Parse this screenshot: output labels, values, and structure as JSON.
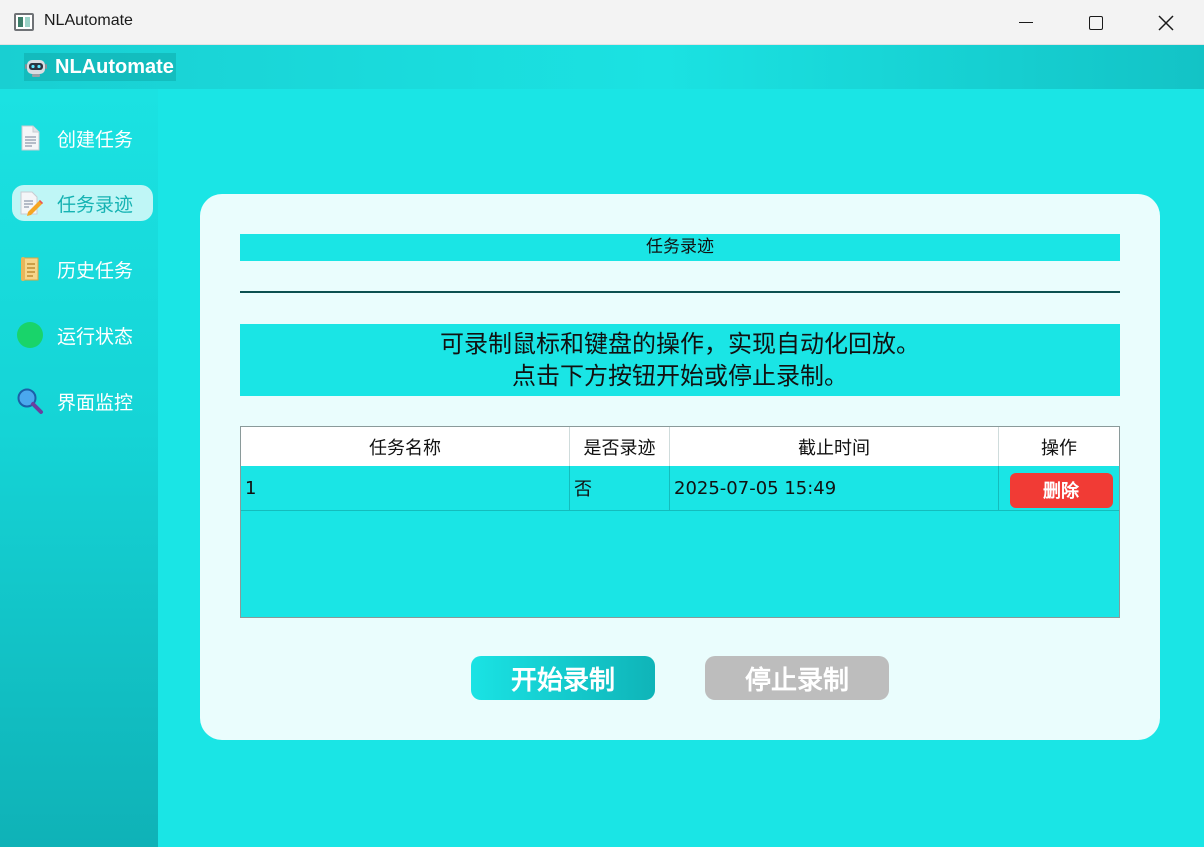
{
  "window": {
    "title": "NLAutomate",
    "controls": [
      "minimize",
      "maximize",
      "close"
    ]
  },
  "header": {
    "brand": "NLAutomate",
    "brand_icon": "robot-icon"
  },
  "sidebar": {
    "items": [
      {
        "label": "创建任务",
        "icon": "document-icon",
        "active": false
      },
      {
        "label": "任务录迹",
        "icon": "pencil-document-icon",
        "active": true
      },
      {
        "label": "历史任务",
        "icon": "scroll-icon",
        "active": false
      },
      {
        "label": "运行状态",
        "icon": "green-circle-icon",
        "active": false
      },
      {
        "label": "界面监控",
        "icon": "magnifier-icon",
        "active": false
      }
    ]
  },
  "main": {
    "title": "任务录迹",
    "intro_line1": "可录制鼠标和键盘的操作，实现自动化回放。",
    "intro_line2": "点击下方按钮开始或停止录制。",
    "table": {
      "headers": [
        "任务名称",
        "是否录迹",
        "截止时间",
        "操作"
      ],
      "rows": [
        {
          "name": "1",
          "recorded": "否",
          "deadline": "2025-07-05 15:49",
          "action": "删除"
        }
      ]
    },
    "start_button": "开始录制",
    "stop_button": "停止录制"
  },
  "colors": {
    "accent": "#1ae5e5",
    "card": "#eafdfd",
    "danger": "#f13b35",
    "disabled": "#bdbdbd"
  }
}
